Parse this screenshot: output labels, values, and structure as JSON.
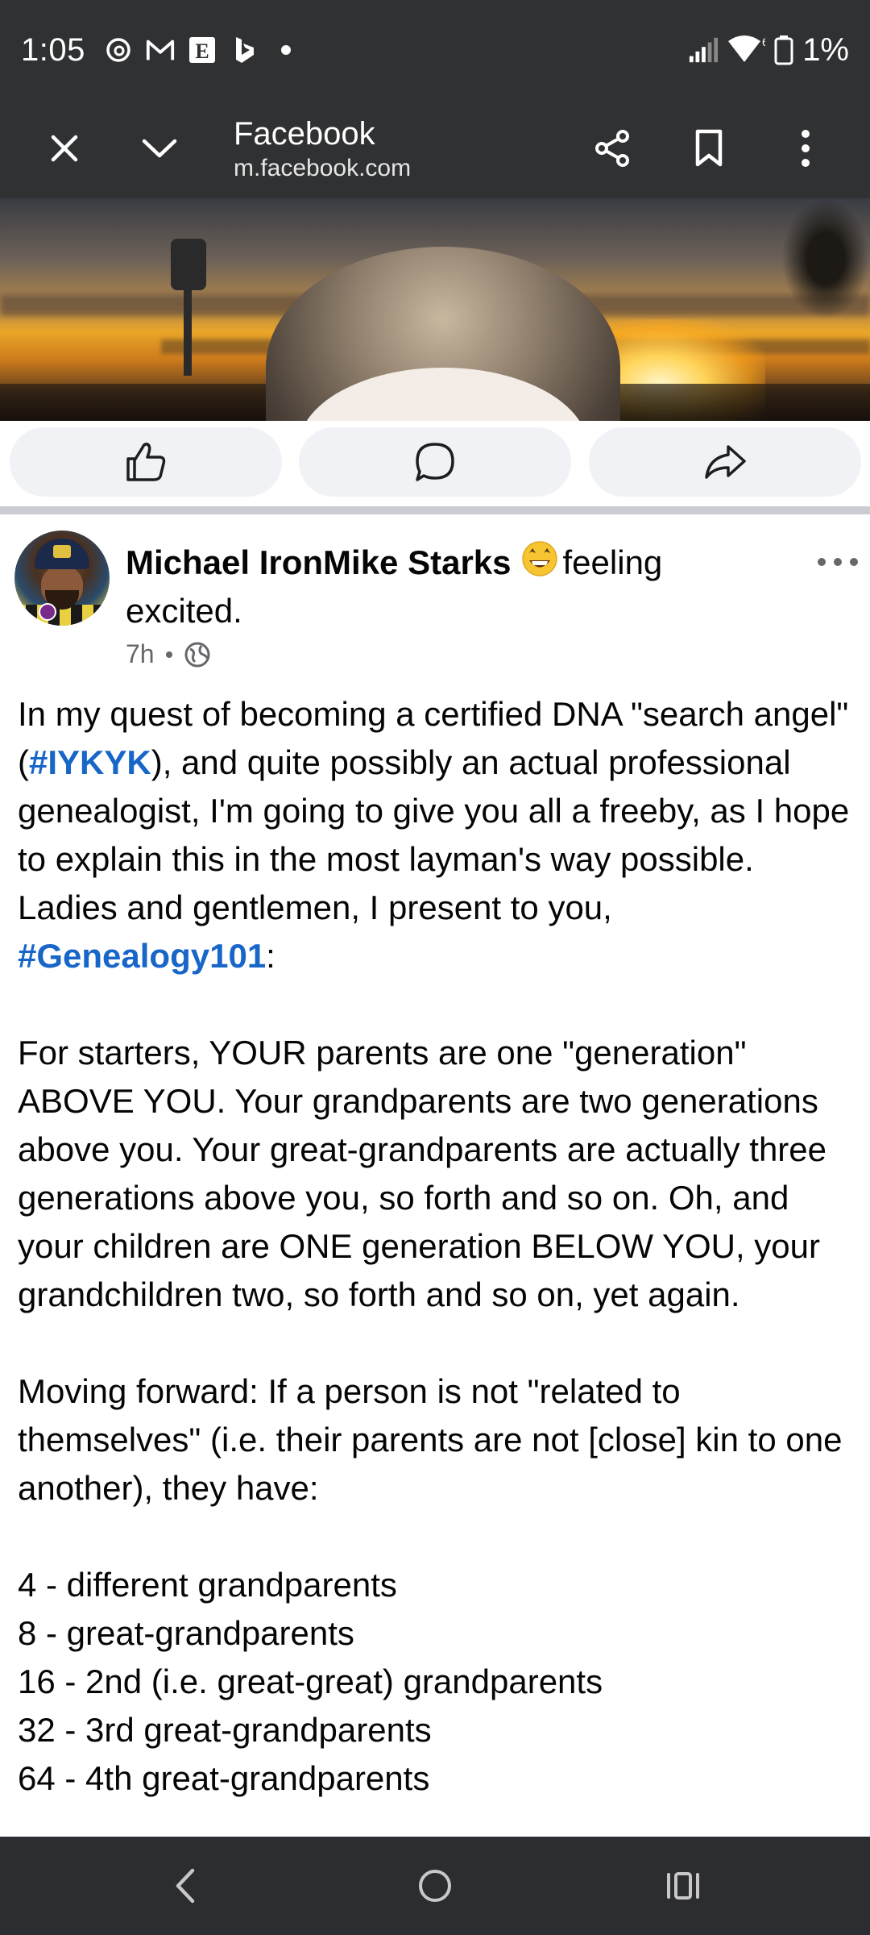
{
  "status_bar": {
    "time": "1:05",
    "notification_icons": [
      "threads-icon",
      "gmail-icon",
      "etsy-icon",
      "bing-icon",
      "dot-icon"
    ],
    "battery_text": "1%",
    "wifi_label": "6"
  },
  "browser": {
    "title": "Facebook",
    "url": "m.facebook.com"
  },
  "post": {
    "author": "Michael IronMike Starks",
    "feeling": "feeling",
    "feeling_word": "excited.",
    "time_ago": "7h",
    "audience": "public",
    "body": {
      "p1_before": "In my quest of becoming a certified DNA \"search angel\" (",
      "p1_tag1": "#IYKYK",
      "p1_mid": "), and quite possibly an actual professional genealogist, I'm going to give you all a freeby, as I hope to explain this in the most layman's way possible.  Ladies and gentlemen, I present to you, ",
      "p1_tag2": "#Genealogy101",
      "p1_after": ":",
      "p2": "For starters, YOUR parents are one \"generation\" ABOVE YOU.  Your grandparents are two generations above you.  Your great-grandparents are actually three generations above you, so forth and so on.  Oh, and your children are ONE generation BELOW YOU, your grandchildren two, so forth and so on, yet again.",
      "p3": "Moving forward: If a person is not \"related to themselves\" (i.e. their parents are not [close] kin to one another), they have:",
      "list": [
        "4 - different grandparents",
        "8 - great-grandparents",
        "16 - 2nd (i.e. great-great) grandparents",
        "32 - 3rd great-grandparents",
        "64 - 4th great-grandparents"
      ]
    }
  },
  "colors": {
    "hashtag": "#1766c8",
    "bar_dark": "#303133",
    "pill_bg": "#f0f2f5"
  }
}
